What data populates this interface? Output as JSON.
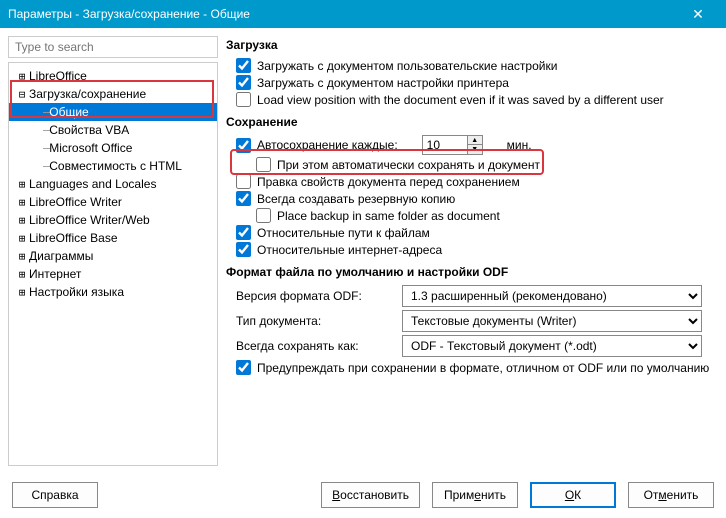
{
  "window": {
    "title": "Параметры - Загрузка/сохранение - Общие"
  },
  "search": {
    "placeholder": "Type to search"
  },
  "tree": {
    "items": [
      {
        "label": "LibreOffice",
        "toggle": "plus",
        "level": 1
      },
      {
        "label": "Загрузка/сохранение",
        "toggle": "minus",
        "level": 1
      },
      {
        "label": "Общие",
        "toggle": "none",
        "level": 2,
        "selected": true
      },
      {
        "label": "Свойства VBA",
        "toggle": "none",
        "level": 2
      },
      {
        "label": "Microsoft Office",
        "toggle": "none",
        "level": 2
      },
      {
        "label": "Совместимость с HTML",
        "toggle": "none",
        "level": 2
      },
      {
        "label": "Languages and Locales",
        "toggle": "plus",
        "level": 1
      },
      {
        "label": "LibreOffice Writer",
        "toggle": "plus",
        "level": 1
      },
      {
        "label": "LibreOffice Writer/Web",
        "toggle": "plus",
        "level": 1
      },
      {
        "label": "LibreOffice Base",
        "toggle": "plus",
        "level": 1
      },
      {
        "label": "Диаграммы",
        "toggle": "plus",
        "level": 1
      },
      {
        "label": "Интернет",
        "toggle": "plus",
        "level": 1
      },
      {
        "label": "Настройки языка",
        "toggle": "plus",
        "level": 1
      }
    ]
  },
  "loading": {
    "title": "Загрузка",
    "user_settings": "Загружать с документом пользовательские настройки",
    "printer_settings": "Загружать с документом настройки принтера",
    "load_view_pos": "Load view position with the document even if it was saved by a different user"
  },
  "saving": {
    "title": "Сохранение",
    "autosave_label": "Автосохранение каждые:",
    "autosave_value": "10",
    "autosave_unit": "мин.",
    "autosave_also_doc": "При этом автоматически сохранять и документ",
    "edit_props": "Правка свойств документа перед сохранением",
    "backup": "Всегда создавать резервную копию",
    "backup_same_folder": "Place backup in same folder as document",
    "rel_paths": "Относительные пути к файлам",
    "rel_urls": "Относительные интернет-адреса"
  },
  "format": {
    "title": "Формат файла по умолчанию и настройки ODF",
    "odf_version_label": "Версия формата ODF:",
    "odf_version_value": "1.3 расширенный (рекомендовано)",
    "doc_type_label": "Тип документа:",
    "doc_type_value": "Текстовые документы (Writer)",
    "always_save_label": "Всегда сохранять как:",
    "always_save_value": "ODF - Текстовый документ (*.odt)",
    "warn": "Предупреждать при сохранении в формате, отличном от ODF или по умолчанию"
  },
  "buttons": {
    "help": "Справка",
    "reset_u": "В",
    "reset_rest": "осстановить",
    "apply_pre": "Прим",
    "apply_u": "е",
    "apply_post": "нить",
    "ok_u": "О",
    "ok_rest": "К",
    "cancel_pre": "От",
    "cancel_u": "м",
    "cancel_post": "енить"
  }
}
